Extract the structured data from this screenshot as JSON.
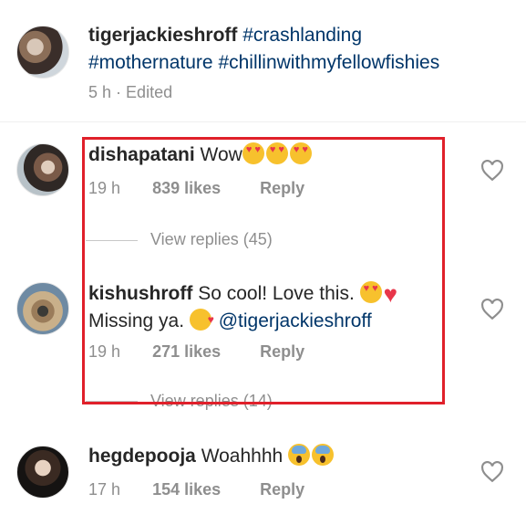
{
  "post": {
    "username": "tigerjackieshroff",
    "caption_tags": [
      "#crashlanding",
      "#mothernature",
      "#chillinwithmyfellowfishies"
    ],
    "time": "5 h",
    "edited": "Edited"
  },
  "comments": [
    {
      "username": "dishapatani",
      "text": "Wow",
      "emojis": [
        "smiling-face-with-heart-eyes",
        "smiling-face-with-heart-eyes",
        "smiling-face-with-heart-eyes"
      ],
      "time": "19 h",
      "likes": "839 likes",
      "reply": "Reply",
      "view_replies": "View replies (45)"
    },
    {
      "username": "kishushroff",
      "text": "So cool! Love this.",
      "text2": "Missing ya.",
      "mention": "@tigerjackieshroff",
      "emojis": [
        "smiling-face-with-heart-eyes",
        "red-heart",
        "face-blowing-a-kiss"
      ],
      "time": "19 h",
      "likes": "271 likes",
      "reply": "Reply",
      "view_replies": "View replies (14)"
    },
    {
      "username": "hegdepooja",
      "text": "Woahhhh",
      "emojis": [
        "face-screaming-in-fear",
        "face-screaming-in-fear"
      ],
      "time": "17 h",
      "likes": "154 likes",
      "reply": "Reply"
    }
  ],
  "colors": {
    "text": "#262626",
    "hashtag": "#003569",
    "meta": "#8e8e8e",
    "highlight": "#e0202a"
  }
}
